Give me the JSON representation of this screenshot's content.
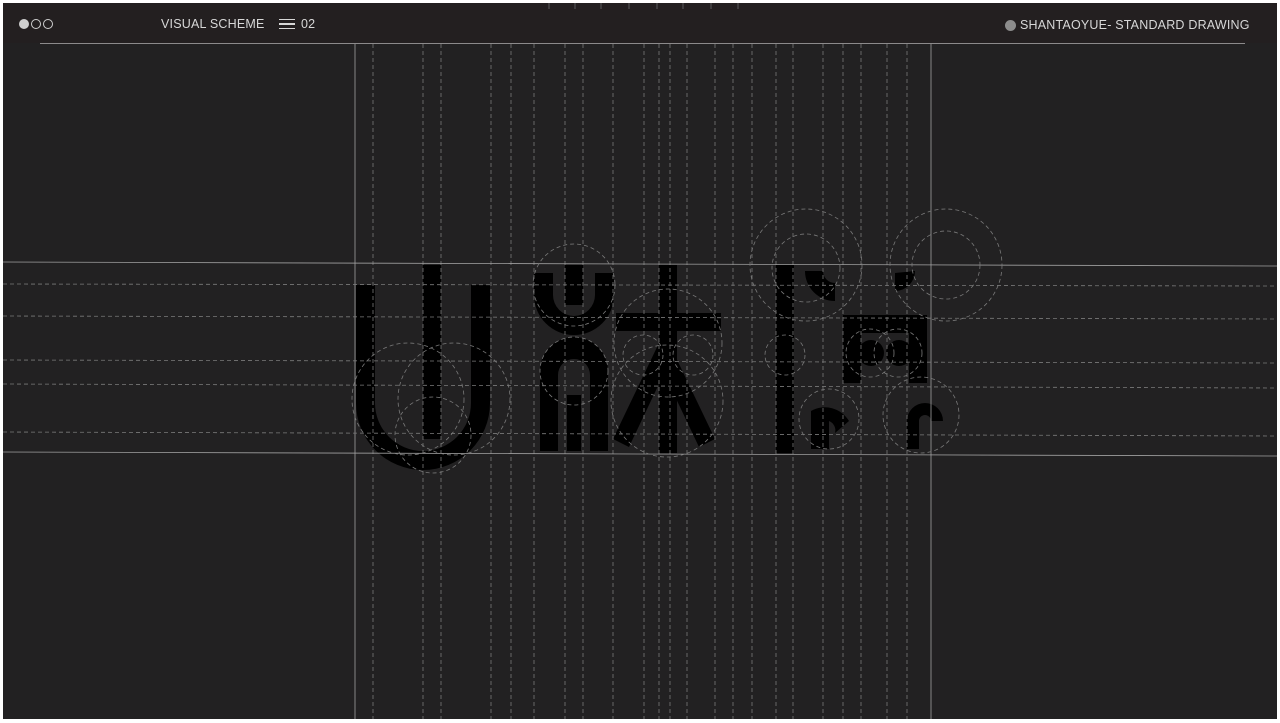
{
  "header": {
    "section_title": "VISUAL SCHEME",
    "menu_icon": "menu-icon",
    "page_number": "02",
    "status_icon": "circle-dot-icon",
    "drawing_title": "SHANTAOYUE- STANDARD DRAWING"
  },
  "window_controls": [
    "filled-circle-icon",
    "outline-circle-icon",
    "outline-circle-icon"
  ],
  "colors": {
    "background": "#222122",
    "header_background": "#231f20",
    "guide_line": "#9a9a9a",
    "logo_fill": "#000000",
    "text": "#d7d7d7"
  }
}
